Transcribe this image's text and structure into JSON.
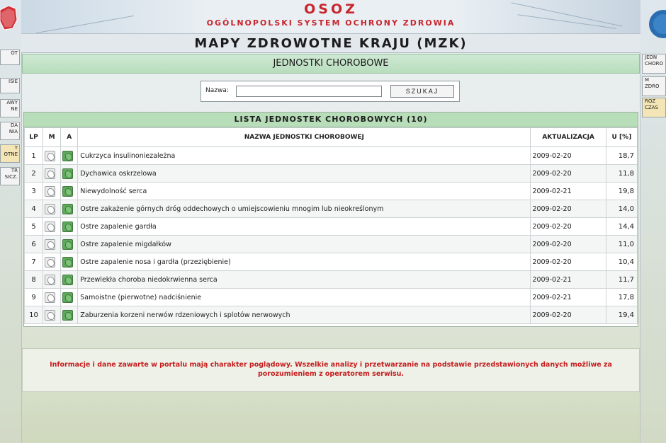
{
  "header": {
    "brand": "OSOZ",
    "subtitle": "OGÓLNOPOLSKI SYSTEM OCHRONY ZDROWIA",
    "title": "MAPY ZDROWOTNE KRAJU (MZK)"
  },
  "left_nav": [
    {
      "label": "ÓT"
    },
    {
      "label": "ISIE"
    },
    {
      "label": "AWY NE"
    },
    {
      "label": "DA NIA"
    },
    {
      "label": "Y OTNE",
      "active": true
    },
    {
      "label": "TR SICZ."
    }
  ],
  "right_nav": [
    {
      "label": "JEDN CHORO"
    },
    {
      "label": "M ZDRO"
    },
    {
      "label": "ROZ CZAS",
      "active": true
    }
  ],
  "page": {
    "heading": "JEDNOSTKI CHOROBOWE",
    "search": {
      "label": "Nazwa:",
      "value": "",
      "placeholder": "",
      "button": "SZUKAJ"
    },
    "list_title": "LISTA JEDNOSTEK CHOROBOWYCH (10)",
    "columns": {
      "lp": "LP",
      "m": "M",
      "a": "A",
      "name": "NAZWA JEDNOSTKI CHOROBOWEJ",
      "updated": "AKTUALIZACJA",
      "pct": "U [%]"
    },
    "rows": [
      {
        "lp": "1",
        "name": "Cukrzyca insulinoniezależna",
        "updated": "2009-02-20",
        "pct": "18,7"
      },
      {
        "lp": "2",
        "name": "Dychawica oskrzelowa",
        "updated": "2009-02-20",
        "pct": "11,8"
      },
      {
        "lp": "3",
        "name": "Niewydolność serca",
        "updated": "2009-02-21",
        "pct": "19,8"
      },
      {
        "lp": "4",
        "name": "Ostre zakażenie górnych dróg oddechowych o umiejscowieniu mnogim lub nieokreślonym",
        "updated": "2009-02-20",
        "pct": "14,0"
      },
      {
        "lp": "5",
        "name": "Ostre zapalenie gardła",
        "updated": "2009-02-20",
        "pct": "14,4"
      },
      {
        "lp": "6",
        "name": "Ostre zapalenie migdałków",
        "updated": "2009-02-20",
        "pct": "11,0"
      },
      {
        "lp": "7",
        "name": "Ostre zapalenie nosa i gardła (przeziębienie)",
        "updated": "2009-02-20",
        "pct": "10,4"
      },
      {
        "lp": "8",
        "name": "Przewlekła choroba niedokrwienna serca",
        "updated": "2009-02-21",
        "pct": "11,7"
      },
      {
        "lp": "9",
        "name": "Samoistne (pierwotne) nadciśnienie",
        "updated": "2009-02-21",
        "pct": "17,8"
      },
      {
        "lp": "10",
        "name": "Zaburzenia korzeni nerwów rdzeniowych i splotów nerwowych",
        "updated": "2009-02-20",
        "pct": "19,4"
      }
    ],
    "info_text": "Informacje i dane zawarte w portalu mają charakter poglądowy. Wszelkie analizy i przetwarzanie na podstawie przedstawionych danych możliwe za porozumieniem z operatorem serwisu."
  },
  "icons": {
    "m": "map-outline-icon",
    "a": "map-green-icon"
  },
  "colors": {
    "accent_red": "#c8252d",
    "heading_green": "#b7ddb9"
  }
}
